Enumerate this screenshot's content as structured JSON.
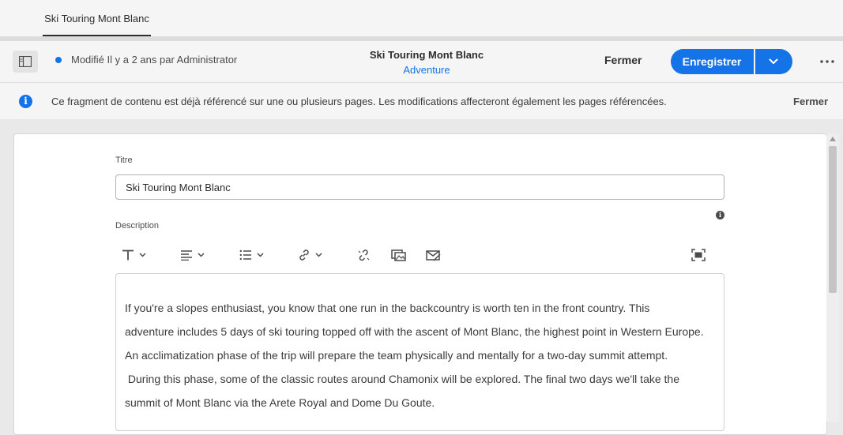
{
  "tabs": [
    {
      "label": "Ski Touring Mont Blanc"
    }
  ],
  "header": {
    "status": "Modifié Il y a 2 ans par Administrator",
    "title": "Ski Touring Mont Blanc",
    "model": "Adventure",
    "close_label": "Fermer",
    "save_label": "Enregistrer"
  },
  "banner": {
    "message": "Ce fragment de contenu est déjà référencé sur une ou plusieurs pages. Les modifications affecteront également les pages référencées.",
    "close_label": "Fermer"
  },
  "form": {
    "title_label": "Titre",
    "title_value": "Ski Touring Mont Blanc",
    "description_label": "Description",
    "description_lines": [
      "If you're a slopes enthusiast, you know that one run in the backcountry is worth ten in the front country. This",
      "adventure includes 5 days of ski touring topped off with the ascent of Mont Blanc, the highest point in Western Europe.",
      "An acclimatization phase of the trip will prepare the team physically and mentally for a two-day summit attempt.",
      " During this phase, some of the classic routes around Chamonix will be explored. The final two days we'll take the",
      "summit of Mont Blanc via the Arete Royal and Dome Du Goute."
    ]
  },
  "toolbar_icons": [
    "text-format-icon",
    "align-icon",
    "list-icon",
    "link-icon",
    "unlink-icon",
    "image-asset-icon",
    "email-link-icon",
    "fullscreen-icon"
  ],
  "colors": {
    "accent": "#1473e6",
    "background": "#e9e9e9"
  }
}
